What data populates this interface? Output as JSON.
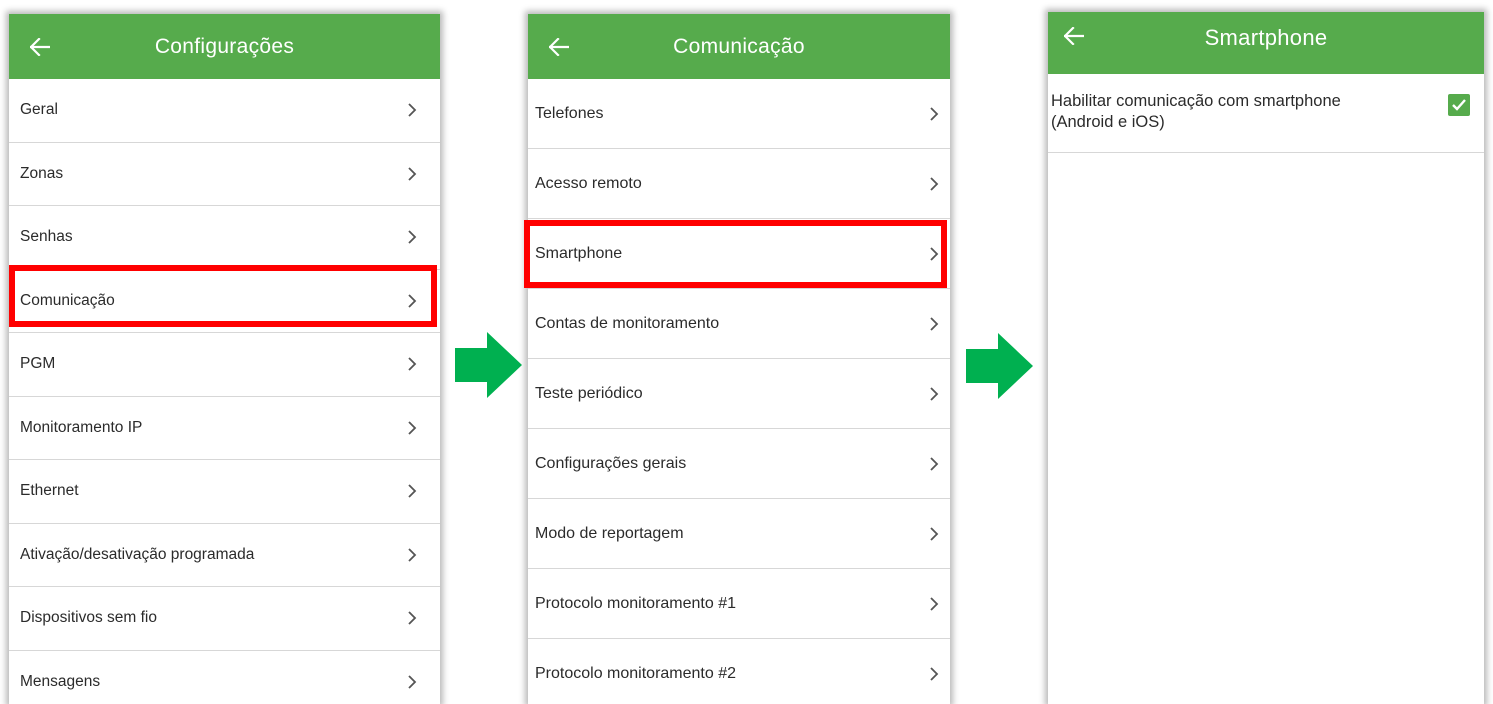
{
  "colors": {
    "appbar": "#56ab4c",
    "highlight": "#ff0000",
    "flow_arrow": "#00b050",
    "checkbox": "#56ab4c"
  },
  "screens": [
    {
      "title": "Configurações",
      "back_icon": "arrow-left-icon",
      "items": [
        {
          "label": "Geral"
        },
        {
          "label": "Zonas"
        },
        {
          "label": "Senhas"
        },
        {
          "label": "Comunicação",
          "highlighted": true
        },
        {
          "label": "PGM"
        },
        {
          "label": "Monitoramento IP"
        },
        {
          "label": "Ethernet"
        },
        {
          "label": "Ativação/desativação programada"
        },
        {
          "label": "Dispositivos sem fio"
        },
        {
          "label": "Mensagens"
        }
      ]
    },
    {
      "title": "Comunicação",
      "back_icon": "arrow-left-icon",
      "items": [
        {
          "label": "Telefones"
        },
        {
          "label": "Acesso remoto"
        },
        {
          "label": "Smartphone",
          "highlighted": true
        },
        {
          "label": "Contas de monitoramento"
        },
        {
          "label": "Teste periódico"
        },
        {
          "label": "Configurações gerais"
        },
        {
          "label": "Modo de reportagem"
        },
        {
          "label": "Protocolo monitoramento #1"
        },
        {
          "label": "Protocolo monitoramento #2"
        }
      ]
    },
    {
      "title": "Smartphone",
      "back_icon": "arrow-left-icon",
      "setting": {
        "label": "Habilitar comunicação com smartphone (Android e iOS)",
        "checked": true
      }
    }
  ]
}
